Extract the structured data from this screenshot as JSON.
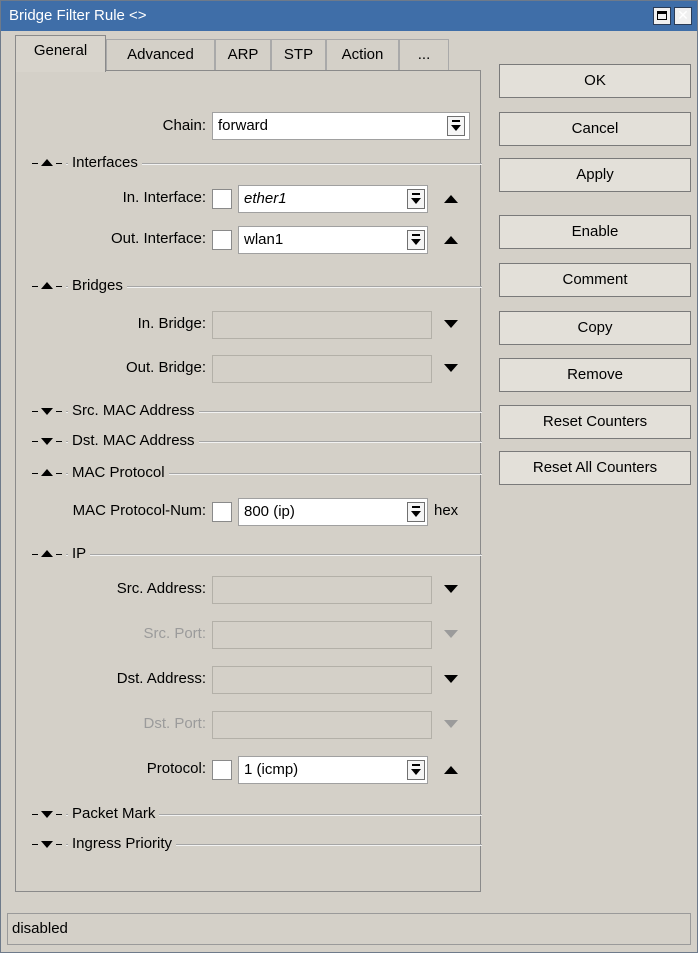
{
  "window": {
    "title": "Bridge Filter Rule <>",
    "close_glyph": "✕"
  },
  "tabs": [
    {
      "label": "General",
      "active": true
    },
    {
      "label": "Advanced"
    },
    {
      "label": "ARP"
    },
    {
      "label": "STP"
    },
    {
      "label": "Action"
    },
    {
      "label": "..."
    }
  ],
  "general": {
    "chain": {
      "label": "Chain:",
      "value": "forward"
    },
    "interfaces": {
      "section": "Interfaces",
      "in_interface": {
        "label": "In. Interface:",
        "value": "ether1"
      },
      "out_interface": {
        "label": "Out. Interface:",
        "value": "wlan1"
      }
    },
    "bridges": {
      "section": "Bridges",
      "in_bridge": {
        "label": "In. Bridge:",
        "value": ""
      },
      "out_bridge": {
        "label": "Out. Bridge:",
        "value": ""
      }
    },
    "src_mac": {
      "section": "Src. MAC Address"
    },
    "dst_mac": {
      "section": "Dst. MAC Address"
    },
    "mac_protocol": {
      "section": "MAC Protocol",
      "num": {
        "label": "MAC Protocol-Num:",
        "value": "800 (ip)",
        "suffix": "hex"
      }
    },
    "ip": {
      "section": "IP",
      "src_address": {
        "label": "Src. Address:",
        "value": ""
      },
      "src_port": {
        "label": "Src. Port:",
        "value": ""
      },
      "dst_address": {
        "label": "Dst. Address:",
        "value": ""
      },
      "dst_port": {
        "label": "Dst. Port:",
        "value": ""
      },
      "protocol": {
        "label": "Protocol:",
        "value": "1 (icmp)"
      }
    },
    "packet_mark": {
      "section": "Packet Mark"
    },
    "ingress_priority": {
      "section": "Ingress Priority"
    }
  },
  "buttons": {
    "ok": "OK",
    "cancel": "Cancel",
    "apply": "Apply",
    "enable": "Enable",
    "comment": "Comment",
    "copy": "Copy",
    "remove": "Remove",
    "reset_counters": "Reset Counters",
    "reset_all_counters": "Reset All Counters"
  },
  "status": {
    "text": "disabled"
  }
}
